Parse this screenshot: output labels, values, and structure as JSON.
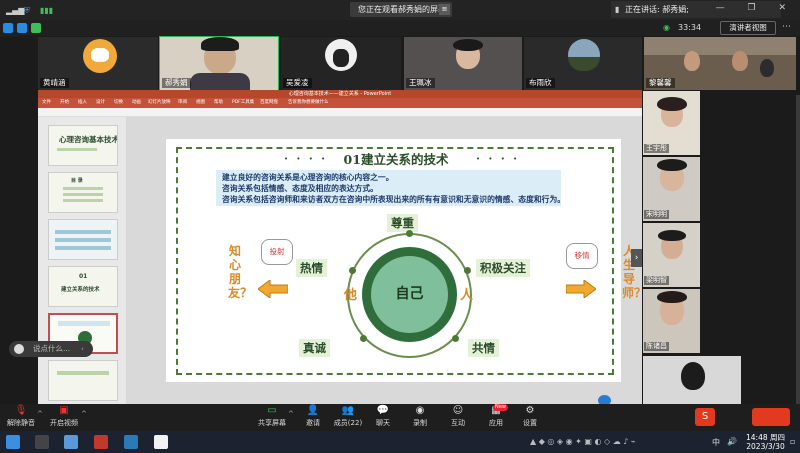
{
  "topbar": {
    "share_banner": "您正在观看郝秀娟的屏幕",
    "speaker": "正在讲话: 郝秀娟;",
    "window_controls": "— ❐ ✕"
  },
  "status": {
    "timer": "33:34",
    "view_button": "演讲者视图"
  },
  "participants_top": [
    "黄靖涵",
    "郝秀娟",
    "吴爱凌",
    "王珮冰",
    "布雨欣"
  ],
  "participants_right": [
    "黎馨馨",
    "王宇彤",
    "宋明明",
    "梁明智",
    "陈诸昌"
  ],
  "ppt": {
    "window_title": "心理咨询基本技术——建立关系 - PowerPoint",
    "ribbon_tabs": [
      "文件",
      "开始",
      "插入",
      "设计",
      "切换",
      "动画",
      "幻灯片放映",
      "审阅",
      "视图",
      "帮助",
      "PDF工具集",
      "百度网盘",
      "告诉我你想要做什么"
    ],
    "thumb1": "心理咨询基本技术",
    "thumb2": "目 录",
    "thumb4a": "01",
    "thumb4b": "建立关系的技术"
  },
  "slide": {
    "title": "01建立关系的技术",
    "title_dots": "• • • •",
    "lines": [
      "建立良好的咨询关系是心理咨询的核心内容之一。",
      "咨询关系包括情感、态度及相应的表达方式。",
      "咨询关系包括咨询师和来访者双方在咨询中所表现出来的所有有意识和无意识的情感、态度和行为。"
    ],
    "center": "自己",
    "left_char": "他",
    "right_char": "人",
    "words": {
      "top": "尊重",
      "upper_left": "热情",
      "upper_right": "积极关注",
      "lower_left": "真诚",
      "lower_right": "共情"
    },
    "left_vertical": "知心朋友？",
    "right_vertical": "人生导师？",
    "bubble_left": "投射",
    "bubble_right": "移情"
  },
  "chat": {
    "placeholder": "说点什么..."
  },
  "toolbar": {
    "mute": "解除静音",
    "video": "开启视频",
    "share": "共享屏幕",
    "invite": "邀请",
    "members": "成员(22)",
    "chat": "聊天",
    "record": "录制",
    "interact": "互动",
    "apps": "应用",
    "settings": "设置",
    "badge_new": "New"
  },
  "taskbar": {
    "ime": "中",
    "time": "14:48 周四",
    "date": "2023/3/30"
  }
}
